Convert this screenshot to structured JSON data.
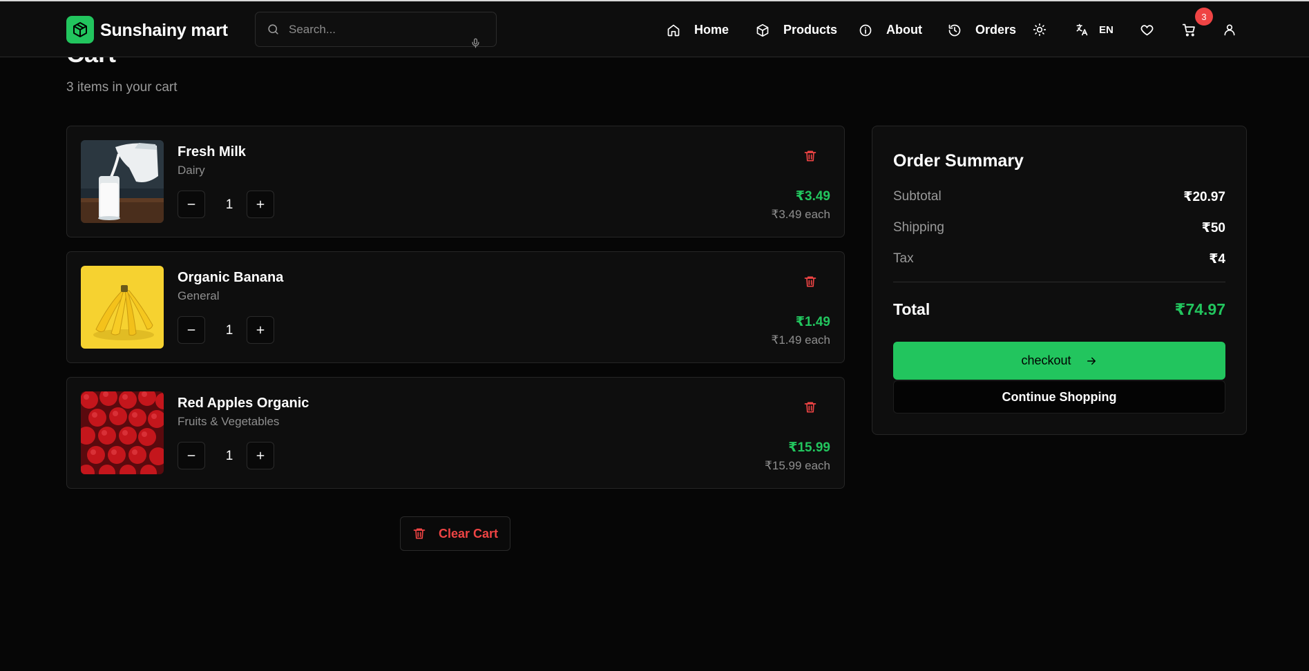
{
  "header": {
    "brand": "Sunshainy mart",
    "search_placeholder": "Search...",
    "nav": [
      {
        "label": "Home",
        "icon": "home-icon"
      },
      {
        "label": "Products",
        "icon": "box-icon"
      },
      {
        "label": "About",
        "icon": "info-icon"
      },
      {
        "label": "Orders",
        "icon": "history-icon"
      }
    ],
    "language": "EN",
    "cart_badge": "3"
  },
  "page": {
    "title": "Cart",
    "item_count": "3 items in your cart"
  },
  "items": [
    {
      "name": "Fresh Milk",
      "category": "Dairy",
      "qty": "1",
      "price": "₹3.49",
      "each": "₹3.49 each",
      "image": "milk-pouring-photo"
    },
    {
      "name": "Organic Banana",
      "category": "General",
      "qty": "1",
      "price": "₹1.49",
      "each": "₹1.49 each",
      "image": "banana-bunch-photo"
    },
    {
      "name": "Red Apples Organic",
      "category": "Fruits & Vegetables",
      "qty": "1",
      "price": "₹15.99",
      "each": "₹15.99 each",
      "image": "red-apples-photo"
    }
  ],
  "clear_cart_label": "Clear Cart",
  "summary": {
    "title": "Order Summary",
    "subtotal_label": "Subtotal",
    "subtotal": "₹20.97",
    "shipping_label": "Shipping",
    "shipping": "₹50",
    "tax_label": "Tax",
    "tax": "₹4",
    "total_label": "Total",
    "total": "₹74.97",
    "checkout_label": "checkout",
    "continue_label": "Continue Shopping"
  },
  "colors": {
    "accent": "#22c55e",
    "danger": "#ef4444",
    "background": "#060606",
    "card": "#0e0e0e"
  }
}
